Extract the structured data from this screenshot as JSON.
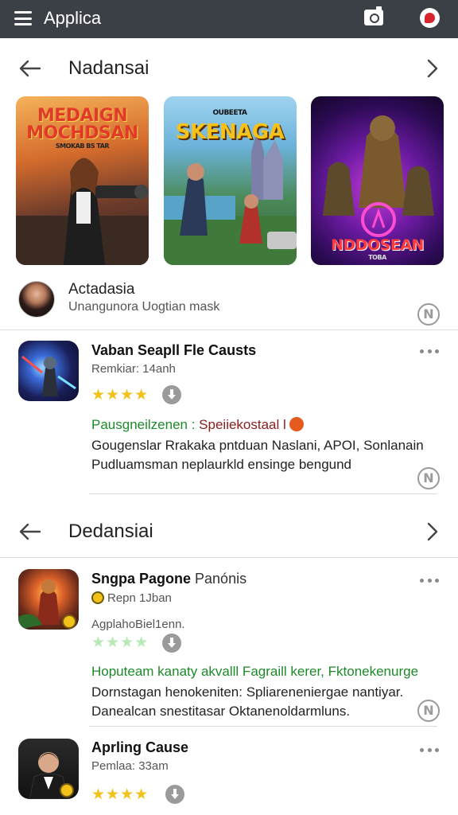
{
  "appbar": {
    "title": "Applica"
  },
  "section1": {
    "title": "Nadansai",
    "banners": [
      {
        "title": "MEDAIGN MOCHDSAN",
        "tagline": "SMOKAB BS TAR"
      },
      {
        "title": "SKENAGA",
        "tagline": "OUBEETA"
      },
      {
        "title": "NDDOSEAN",
        "tagline": "TOBA"
      }
    ]
  },
  "featured": {
    "name": "Actadasia",
    "subtitle": "Unangunora Uogtian mask"
  },
  "apps": [
    {
      "name": "Vaban Seapll Fle Causts",
      "meta": "Remkiar: 14anh",
      "stars_filled": 4,
      "star_color": "#f2c21b",
      "promo_green": "Pausgneilzenen :",
      "promo_red": "Speiiekostaal l",
      "description": "Gougenslar Rrakaka pntduan Naslani, APOI, Sonlanain Pudluamsman neplaurkld ensinge bengund"
    },
    {
      "name": "Sngpa Pagone",
      "name_suffix": "Panónis",
      "meta": "Repn 1Jban",
      "meta2": "AgplahoBiel1enn.",
      "stars_filled": 4,
      "star_color": "#b9eab6",
      "promo_green": "Hoputeam kanaty akvalll Fagraill kerer, Fktonekenurge",
      "description": "Dornstagan henokeniten: Spliareneniergae nantiyar. Danealcan snestitasar Oktanenoldarmluns."
    },
    {
      "name": "Aprling Cause",
      "meta": "Pemlaa: 33am",
      "stars_filled": 4,
      "star_color": "#f2c21b"
    }
  ],
  "section2": {
    "title": "Dedansiai"
  },
  "colors": {
    "appbar": "#3b3f46",
    "star_gold": "#f2c21b",
    "promo_green": "#1d8a2a"
  }
}
